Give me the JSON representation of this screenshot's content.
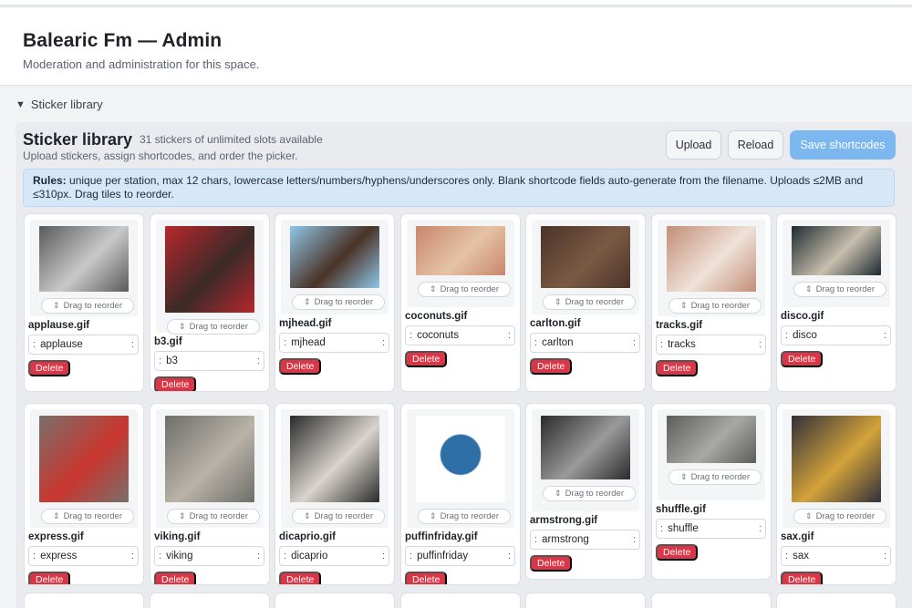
{
  "header": {
    "title": "Balearic Fm — Admin",
    "subtitle": "Moderation and administration for this space."
  },
  "section_toggle": {
    "label": "Sticker library"
  },
  "library": {
    "title": "Sticker library",
    "count": "31 stickers of unlimited slots available",
    "description": "Upload stickers, assign shortcodes, and order the picker.",
    "buttons": {
      "upload": "Upload",
      "reload": "Reload",
      "save": "Save shortcodes"
    },
    "rules_label": "Rules:",
    "rules_text": " unique per station, max 12 chars, lowercase letters/numbers/hyphens/underscores only. Blank shortcode fields auto-generate from the filename. Uploads ≤2MB and ≤310px. Drag tiles to reorder.",
    "drag_label": "Drag to reorder",
    "delete_label": "Delete",
    "colon": ":",
    "stickers": [
      {
        "file": "applause.gif",
        "code": "applause",
        "bg": "#5a5a5a",
        "fg": "#c9c9c9"
      },
      {
        "file": "b3.gif",
        "code": "b3",
        "bg": "#b8272c",
        "fg": "#3a2a28"
      },
      {
        "file": "mjhead.gif",
        "code": "mjhead",
        "bg": "#8fc7e8",
        "fg": "#4a3226"
      },
      {
        "file": "coconuts.gif",
        "code": "coconuts",
        "bg": "#c9866a",
        "fg": "#e5c3a6"
      },
      {
        "file": "carlton.gif",
        "code": "carlton",
        "bg": "#4b3328",
        "fg": "#7a5a44"
      },
      {
        "file": "tracks.gif",
        "code": "tracks",
        "bg": "#c38e78",
        "fg": "#efe2d8"
      },
      {
        "file": "disco.gif",
        "code": "disco",
        "bg": "#1d2a30",
        "fg": "#c8bfae"
      },
      {
        "file": "express.gif",
        "code": "express",
        "bg": "#7a6f6a",
        "fg": "#c9362f"
      },
      {
        "file": "viking.gif",
        "code": "viking",
        "bg": "#6e6e6a",
        "fg": "#b9b3a8"
      },
      {
        "file": "dicaprio.gif",
        "code": "dicaprio",
        "bg": "#2b2b2b",
        "fg": "#d9d4cc"
      },
      {
        "file": "puffinfriday.gif",
        "code": "puffinfriday",
        "bg": "#ffffff",
        "fg": "#2e6fa7"
      },
      {
        "file": "armstrong.gif",
        "code": "armstrong",
        "bg": "#2a2a2a",
        "fg": "#9a9a9a"
      },
      {
        "file": "shuffle.gif",
        "code": "shuffle",
        "bg": "#5c5c5a",
        "fg": "#a8a8a4"
      },
      {
        "file": "sax.gif",
        "code": "sax",
        "bg": "#30303a",
        "fg": "#d4a33a"
      }
    ]
  }
}
